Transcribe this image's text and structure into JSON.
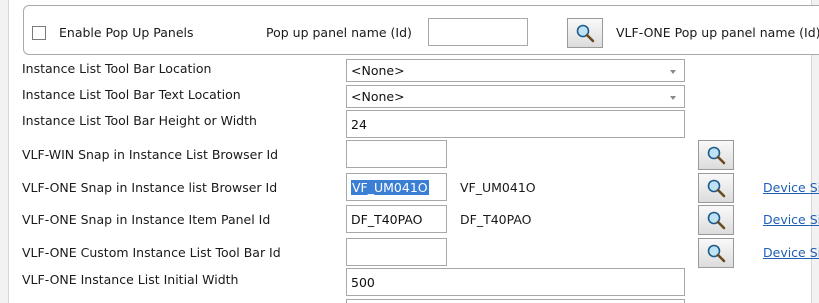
{
  "header": {
    "enable_label": "Enable Pop Up Panels",
    "popup_name_label": "Pop up panel name (Id)",
    "popup_name_value": "",
    "vlf_one_popup_label": "VLF-ONE Pop up panel name (Id)"
  },
  "rows": {
    "toolbar_location": {
      "label": "Instance List Tool Bar Location",
      "value": "<None>"
    },
    "toolbar_text_location": {
      "label": "Instance List Tool Bar Text Location",
      "value": "<None>"
    },
    "toolbar_height": {
      "label": "Instance List Tool Bar Height or Width",
      "value": "24"
    },
    "win_snap": {
      "label": "VLF-WIN Snap in Instance List Browser Id",
      "value": ""
    },
    "one_snap_browser": {
      "label": "VLF-ONE Snap in Instance list Browser Id",
      "value": "VF_UM041O",
      "resolved": "VF_UM041O",
      "link": "Device Si"
    },
    "one_snap_item": {
      "label": "VLF-ONE Snap in Instance Item Panel Id",
      "value": "DF_T40PAO",
      "resolved": "DF_T40PAO",
      "link": "Device Si"
    },
    "one_custom_toolbar": {
      "label": "VLF-ONE Custom Instance List Tool Bar Id",
      "value": "",
      "link": "Device Si"
    },
    "one_initial_width": {
      "label": "VLF-ONE Instance List Initial Width",
      "value": "500"
    }
  },
  "icons": {
    "lookup": "magnifier-icon"
  },
  "colors": {
    "selection": "#3b7fd4",
    "link": "#1f5fb5",
    "border": "#a8a8a8"
  }
}
